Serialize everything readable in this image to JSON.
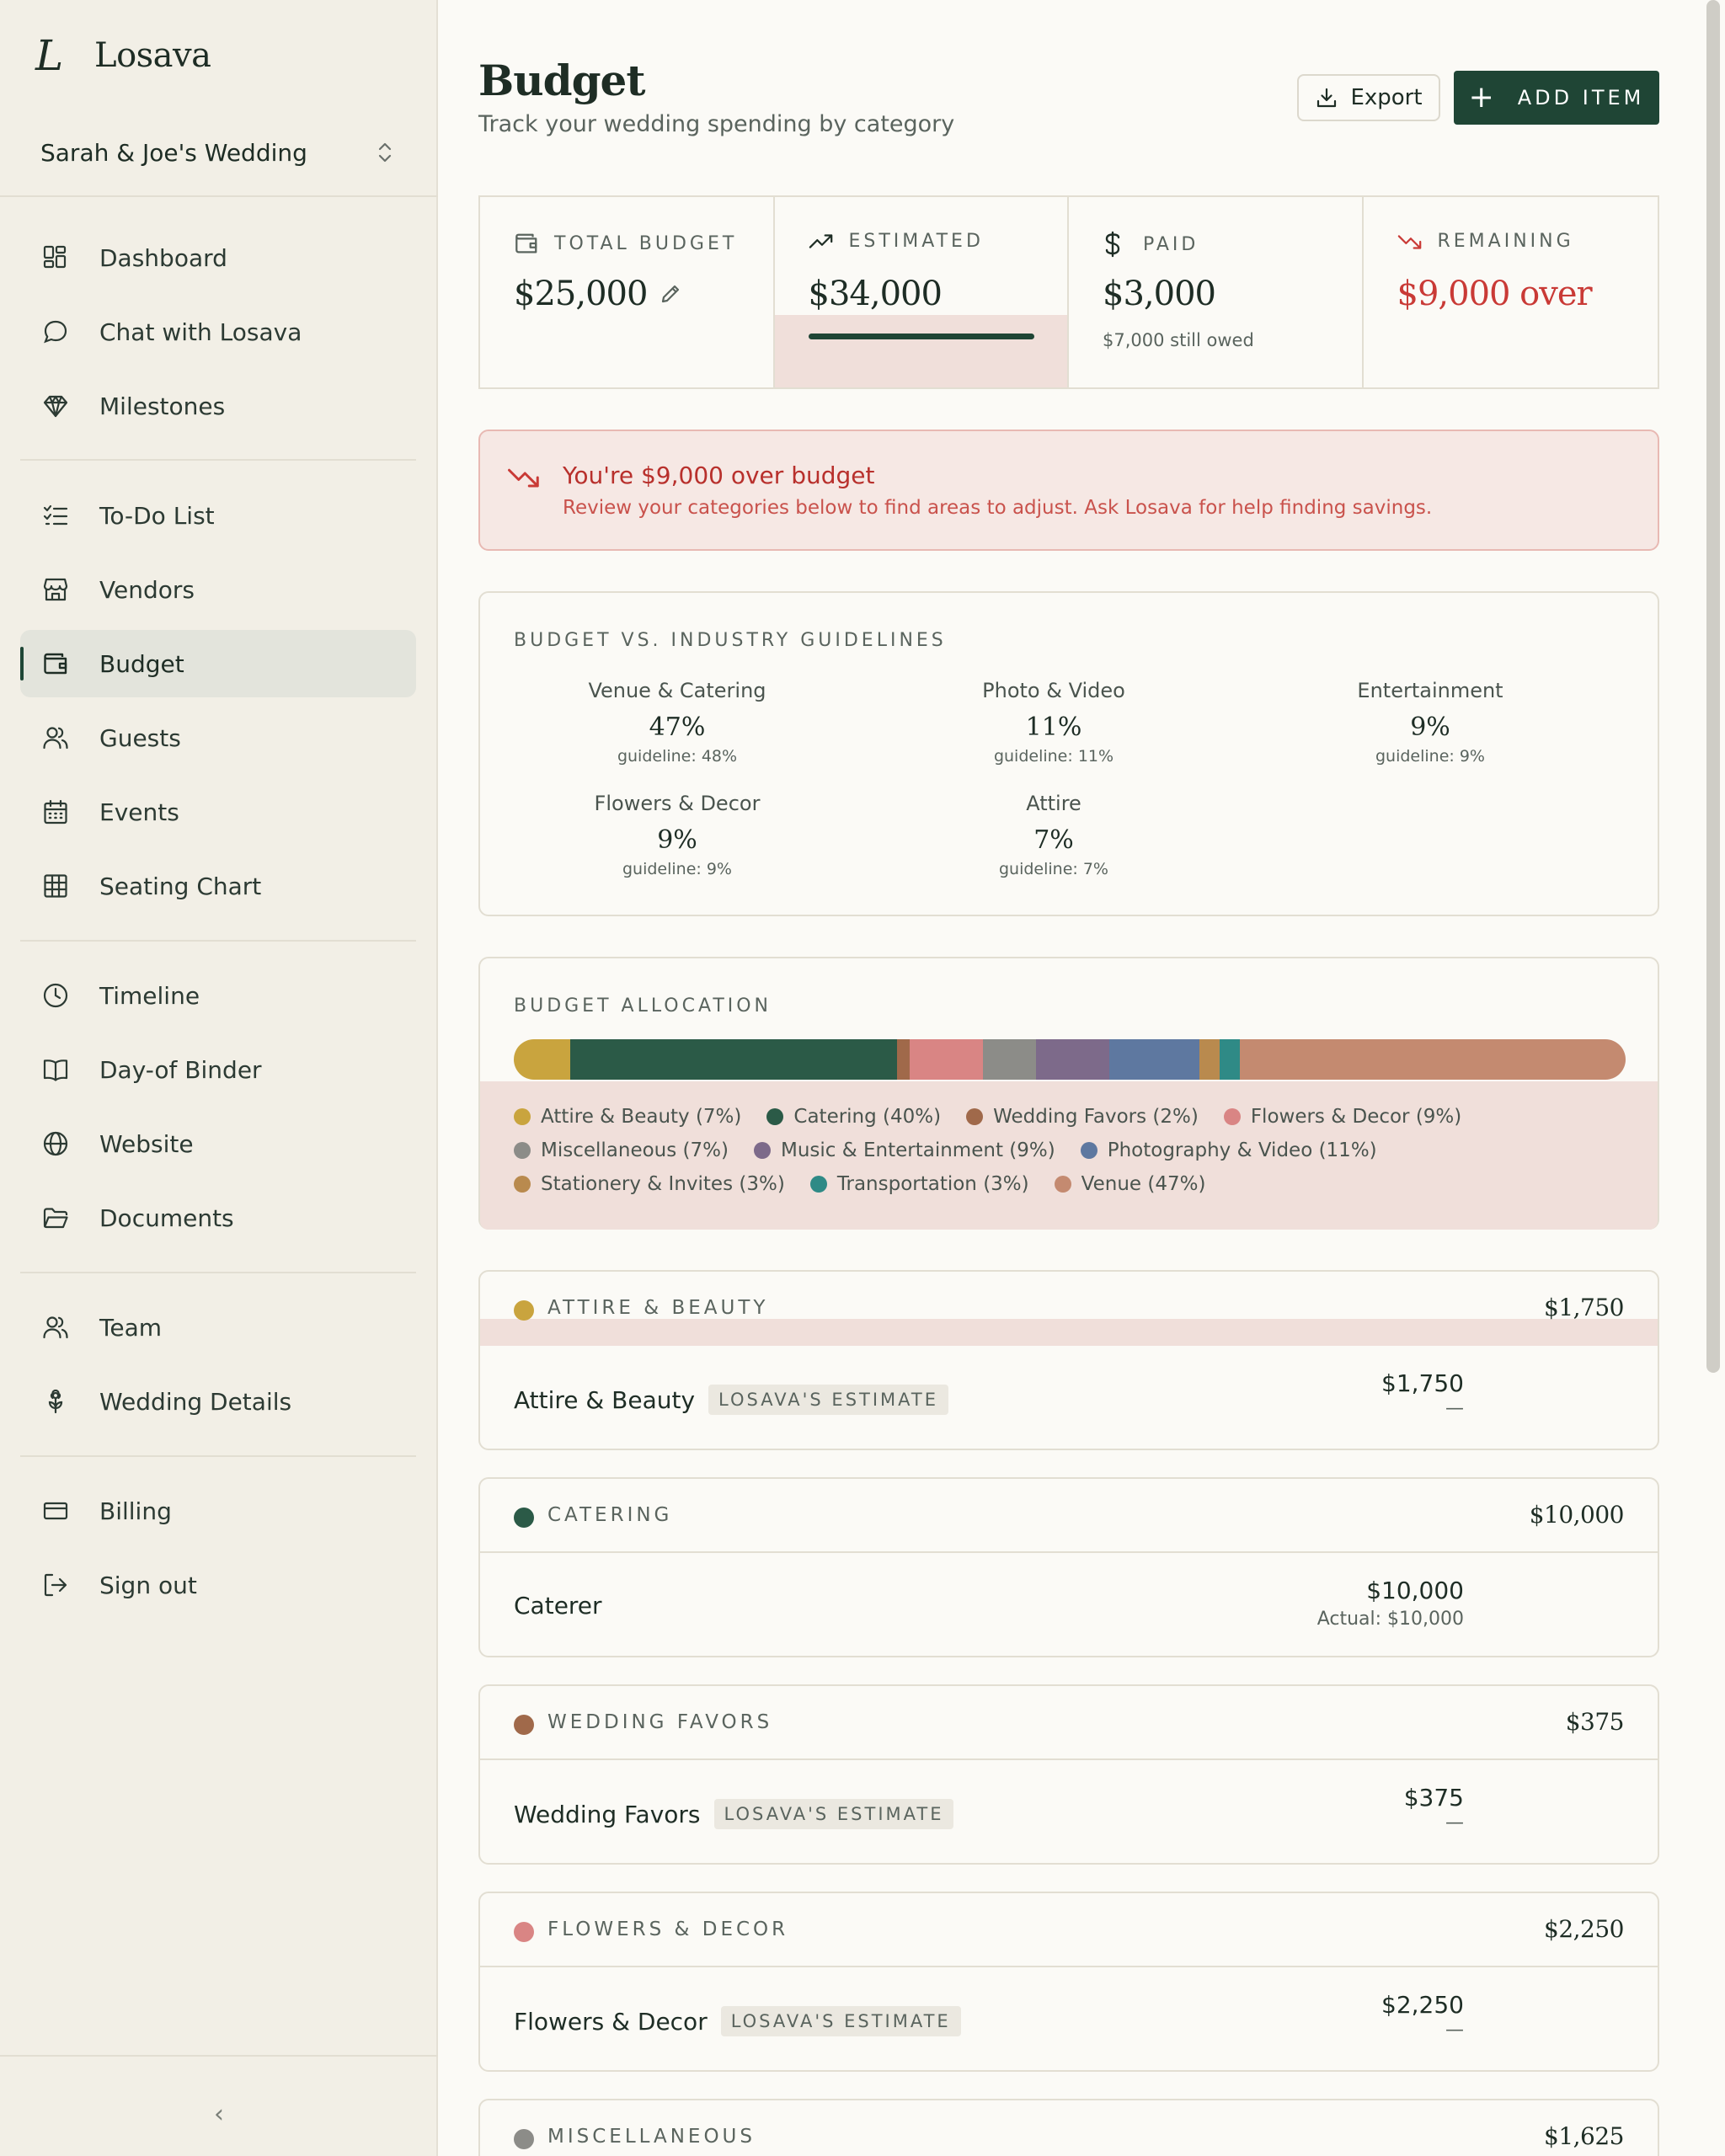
{
  "brand": {
    "logo_mark": "L",
    "name": "Losava"
  },
  "wedding_selector": {
    "label": "Sarah & Joe's Wedding"
  },
  "sidebar": {
    "items": [
      {
        "label": "Dashboard",
        "icon": "dashboard-icon"
      },
      {
        "label": "Chat with Losava",
        "icon": "chat-icon"
      },
      {
        "label": "Milestones",
        "icon": "diamond-icon"
      },
      {
        "label": "To-Do List",
        "icon": "checklist-icon"
      },
      {
        "label": "Vendors",
        "icon": "store-icon"
      },
      {
        "label": "Budget",
        "icon": "wallet-icon",
        "active": true
      },
      {
        "label": "Guests",
        "icon": "users-icon"
      },
      {
        "label": "Events",
        "icon": "calendar-icon"
      },
      {
        "label": "Seating Chart",
        "icon": "grid-icon"
      },
      {
        "label": "Timeline",
        "icon": "clock-icon"
      },
      {
        "label": "Day-of Binder",
        "icon": "book-icon"
      },
      {
        "label": "Website",
        "icon": "globe-icon"
      },
      {
        "label": "Documents",
        "icon": "folder-icon"
      },
      {
        "label": "Team",
        "icon": "team-icon"
      },
      {
        "label": "Wedding Details",
        "icon": "flower-icon"
      },
      {
        "label": "Billing",
        "icon": "card-icon"
      },
      {
        "label": "Sign out",
        "icon": "sign-out-icon"
      }
    ],
    "collapse_glyph": "‹"
  },
  "header": {
    "title": "Budget",
    "subtitle": "Track your wedding spending by category",
    "export_label": "Export",
    "add_label": "ADD ITEM",
    "add_glyph": "+"
  },
  "stats": {
    "total": {
      "label": "TOTAL BUDGET",
      "value": "$25,000"
    },
    "estimated": {
      "label": "ESTIMATED",
      "value": "$34,000"
    },
    "paid": {
      "label": "PAID",
      "value": "$3,000",
      "note": "$7,000 still owed"
    },
    "remaining": {
      "label": "REMAINING",
      "value": "$9,000 over"
    }
  },
  "alert": {
    "title": "You're $9,000 over budget",
    "text": "Review your categories below to find areas to adjust. Ask Losava for help finding savings."
  },
  "guidelines": {
    "heading": "BUDGET VS. INDUSTRY GUIDELINES",
    "items": [
      {
        "name": "Venue & Catering",
        "pct": "47%",
        "guide": "guideline: 48%"
      },
      {
        "name": "Photo & Video",
        "pct": "11%",
        "guide": "guideline: 11%"
      },
      {
        "name": "Entertainment",
        "pct": "9%",
        "guide": "guideline: 9%"
      },
      {
        "name": "Flowers & Decor",
        "pct": "9%",
        "guide": "guideline: 9%"
      },
      {
        "name": "Attire",
        "pct": "7%",
        "guide": "guideline: 7%"
      }
    ]
  },
  "allocation": {
    "heading": "BUDGET ALLOCATION",
    "legend": [
      {
        "label": "Attire & Beauty (7%)",
        "color": "#c9a43e",
        "share": 5.1
      },
      {
        "label": "Catering (40%)",
        "color": "#2b5a47",
        "share": 29.4
      },
      {
        "label": "Wedding Favors (2%)",
        "color": "#a0694a",
        "share": 1.1
      },
      {
        "label": "Flowers & Decor (9%)",
        "color": "#d98584",
        "share": 6.6
      },
      {
        "label": "Miscellaneous (7%)",
        "color": "#8c8c88",
        "share": 4.8
      },
      {
        "label": "Music & Entertainment (9%)",
        "color": "#7d6a8a",
        "share": 6.6
      },
      {
        "label": "Photography & Video (11%)",
        "color": "#5e78a0",
        "share": 8.1
      },
      {
        "label": "Stationery & Invites (3%)",
        "color": "#b98a4e",
        "share": 1.8
      },
      {
        "label": "Transportation (3%)",
        "color": "#2f8a86",
        "share": 1.8
      },
      {
        "label": "Venue (47%)",
        "color": "#c48a70",
        "share": 34.7
      }
    ]
  },
  "categories": [
    {
      "label": "ATTIRE & BEAUTY",
      "color": "#c9a43e",
      "total": "$1,750",
      "item": "Attire & Beauty",
      "tag": "LOSAVA'S ESTIMATE",
      "amount": "$1,750",
      "sub": "—"
    },
    {
      "label": "CATERING",
      "color": "#2b5a47",
      "total": "$10,000",
      "item": "Caterer",
      "tag": "",
      "amount": "$10,000",
      "sub": "Actual: $10,000"
    },
    {
      "label": "WEDDING FAVORS",
      "color": "#a0694a",
      "total": "$375",
      "item": "Wedding Favors",
      "tag": "LOSAVA'S ESTIMATE",
      "amount": "$375",
      "sub": "—"
    },
    {
      "label": "FLOWERS & DECOR",
      "color": "#d98584",
      "total": "$2,250",
      "item": "Flowers & Decor",
      "tag": "LOSAVA'S ESTIMATE",
      "amount": "$2,250",
      "sub": "—"
    },
    {
      "label": "MISCELLANEOUS",
      "color": "#8c8c88",
      "total": "$1,625"
    }
  ]
}
